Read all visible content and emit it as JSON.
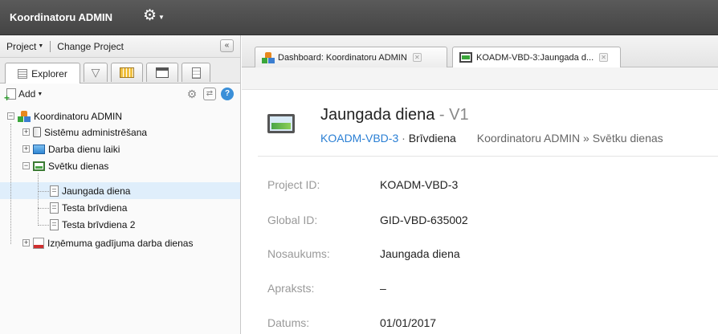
{
  "app": {
    "title": "Koordinatoru ADMIN"
  },
  "project_bar": {
    "project_label": "Project",
    "change_label": "Change Project",
    "collapse_label": "«"
  },
  "left_tabs": {
    "explorer_label": "Explorer"
  },
  "explorer_toolbar": {
    "add_label": "Add"
  },
  "tree": {
    "root": "Koordinatoru ADMIN",
    "items": [
      {
        "label": "Sistēmu administrēšana"
      },
      {
        "label": "Darba dienu laiki"
      },
      {
        "label": "Svētku dienas"
      },
      {
        "label": "Jaungada diena"
      },
      {
        "label": "Testa brīvdiena"
      },
      {
        "label": "Testa brīvdiena 2"
      },
      {
        "label": "Izņēmuma gadījuma darba dienas"
      }
    ]
  },
  "tabs": [
    {
      "label": "Dashboard: Koordinatoru ADMIN"
    },
    {
      "label": "KOADM-VBD-3:Jaungada d..."
    }
  ],
  "record": {
    "title": "Jaungada diena",
    "version": "V1",
    "id_link": "KOADM-VBD-3",
    "separator": " · ",
    "type": "Brīvdiena",
    "breadcrumb": "Koordinatoru ADMIN » Svētku dienas"
  },
  "fields": [
    {
      "label": "Project ID:",
      "value": "KOADM-VBD-3"
    },
    {
      "label": "Global ID:",
      "value": "GID-VBD-635002"
    },
    {
      "label": "Nosaukums:",
      "value": "Jaungada diena"
    },
    {
      "label": "Apraksts:",
      "value": "–"
    },
    {
      "label": "Datums:",
      "value": "01/01/2017"
    }
  ]
}
